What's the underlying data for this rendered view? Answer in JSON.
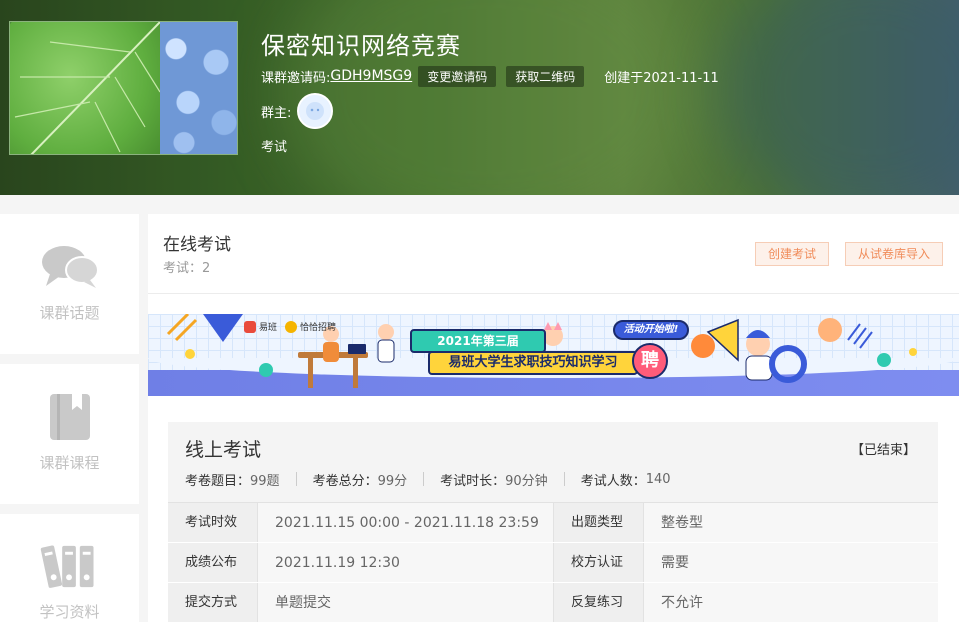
{
  "header": {
    "title": "保密知识网络竞赛",
    "invite_label": "课群邀请码:",
    "invite_code": "GDH9MSG9",
    "change_code_button": "变更邀请码",
    "qr_button": "获取二维码",
    "created": "创建于2021-11-11",
    "owner_label": "群主:",
    "tag": "考试"
  },
  "sidebar": {
    "items": [
      {
        "label": "课群话题",
        "icon": "chat-bubbles-icon"
      },
      {
        "label": "课群课程",
        "icon": "book-icon"
      },
      {
        "label": "学习资料",
        "icon": "binders-icon"
      }
    ]
  },
  "main": {
    "section_title": "在线考试",
    "exam_count": "考试：2",
    "create_button": "创建考试",
    "import_button": "从试卷库导入",
    "banner": {
      "logo_a": "易班",
      "logo_b": "恰恰招聘",
      "headline": "2021年第三届",
      "subline": "易班大学生求职技巧知识学习",
      "badge": "活动开始啦!",
      "stamp": "聘"
    },
    "exam": {
      "title": "线上考试",
      "status": "【已结束】",
      "stats": [
        {
          "label": "考卷题目：",
          "value": "99题"
        },
        {
          "label": "考卷总分：",
          "value": "99分"
        },
        {
          "label": "考试时长：",
          "value": "90分钟"
        },
        {
          "label": "考试人数：",
          "value": "140"
        }
      ],
      "rows": [
        {
          "k1": "考试时效",
          "v1": "2021.11.15 00:00 - 2021.11.18 23:59",
          "k2": "出题类型",
          "v2": "整卷型"
        },
        {
          "k1": "成绩公布",
          "v1": "2021.11.19 12:30",
          "k2": "校方认证",
          "v2": "需要"
        },
        {
          "k1": "提交方式",
          "v1": "单题提交",
          "k2": "反复练习",
          "v2": "不允许"
        }
      ]
    }
  },
  "colors": {
    "accent_orange": "#f08c5a",
    "header_green": "#4c7d33"
  }
}
